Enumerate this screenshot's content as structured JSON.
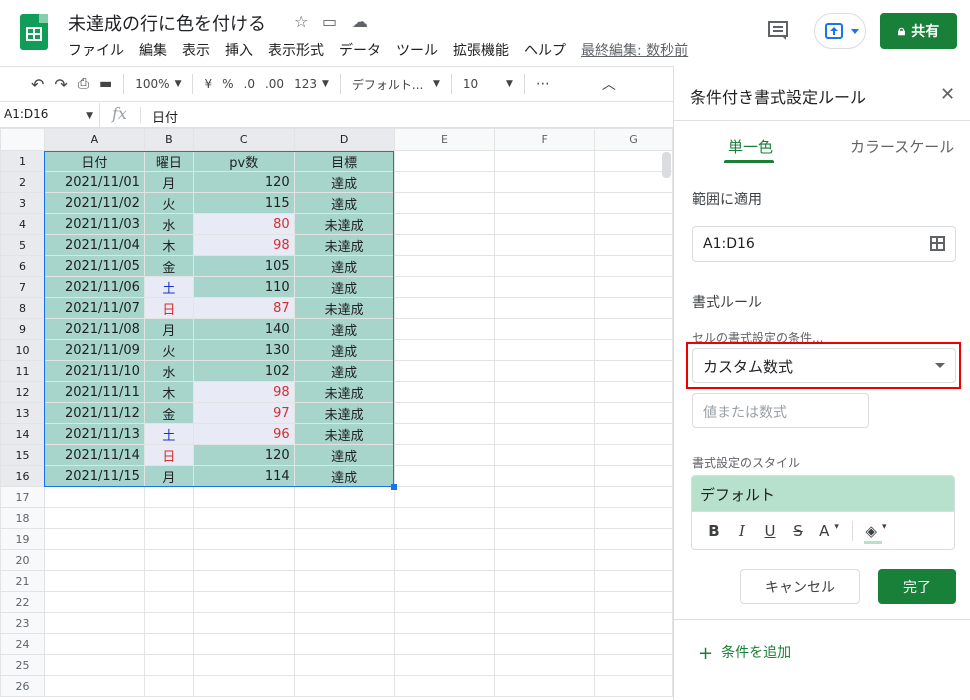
{
  "doc": {
    "title": "未達成の行に色を付ける",
    "menus": [
      "ファイル",
      "編集",
      "表示",
      "挿入",
      "表示形式",
      "データ",
      "ツール",
      "拡張機能",
      "ヘルプ"
    ],
    "last_edit": "最終編集: 数秒前",
    "share_label": "共有"
  },
  "toolbar": {
    "zoom": "100%",
    "currency": "¥",
    "percent": "%",
    "dec_less": ".0",
    "dec_more": ".00",
    "number_format": "123",
    "font": "デフォルト...",
    "font_size": "10"
  },
  "formula_bar": {
    "name_box": "A1:D16",
    "fx": "fx",
    "content": "日付"
  },
  "grid": {
    "columns": [
      "A",
      "B",
      "C",
      "D",
      "E",
      "F",
      "G"
    ],
    "rows": [
      [
        "日付",
        "曜日",
        "pv数",
        "目標"
      ],
      [
        "2021/11/01",
        "月",
        "120",
        "達成"
      ],
      [
        "2021/11/02",
        "火",
        "115",
        "達成"
      ],
      [
        "2021/11/03",
        "水",
        "80",
        "未達成"
      ],
      [
        "2021/11/04",
        "木",
        "98",
        "未達成"
      ],
      [
        "2021/11/05",
        "金",
        "105",
        "達成"
      ],
      [
        "2021/11/06",
        "土",
        "110",
        "達成"
      ],
      [
        "2021/11/07",
        "日",
        "87",
        "未達成"
      ],
      [
        "2021/11/08",
        "月",
        "140",
        "達成"
      ],
      [
        "2021/11/09",
        "火",
        "130",
        "達成"
      ],
      [
        "2021/11/10",
        "水",
        "102",
        "達成"
      ],
      [
        "2021/11/11",
        "木",
        "98",
        "未達成"
      ],
      [
        "2021/11/12",
        "金",
        "97",
        "未達成"
      ],
      [
        "2021/11/13",
        "土",
        "96",
        "未達成"
      ],
      [
        "2021/11/14",
        "日",
        "120",
        "達成"
      ],
      [
        "2021/11/15",
        "月",
        "114",
        "達成"
      ]
    ],
    "row_numbers": [
      "1",
      "2",
      "3",
      "4",
      "5",
      "6",
      "7",
      "8",
      "9",
      "10",
      "11",
      "12",
      "13",
      "14",
      "15",
      "16",
      "17",
      "18",
      "19",
      "20",
      "21",
      "22",
      "23",
      "24",
      "25",
      "26"
    ]
  },
  "panel": {
    "title": "条件付き書式設定ルール",
    "tab_single": "単一色",
    "tab_scale": "カラースケール",
    "range_label": "範囲に適用",
    "range_value": "A1:D16",
    "rules_label": "書式ルール",
    "condition_label": "セルの書式設定の条件...",
    "condition_value": "カスタム数式",
    "value_placeholder": "値または数式",
    "style_label": "書式設定のスタイル",
    "style_preview": "デフォルト",
    "style_tools": [
      "B",
      "I",
      "U",
      "S",
      "A"
    ],
    "cancel": "キャンセル",
    "done": "完了",
    "add_rule": "条件を追加"
  },
  "colors": {
    "accent": "#188038",
    "range_fill": "#a8d5cb",
    "highlight": "#e8eaf6",
    "warn_text": "#d32f2f",
    "weekend_blue": "#1a32c8",
    "callout": "#ee0000"
  }
}
